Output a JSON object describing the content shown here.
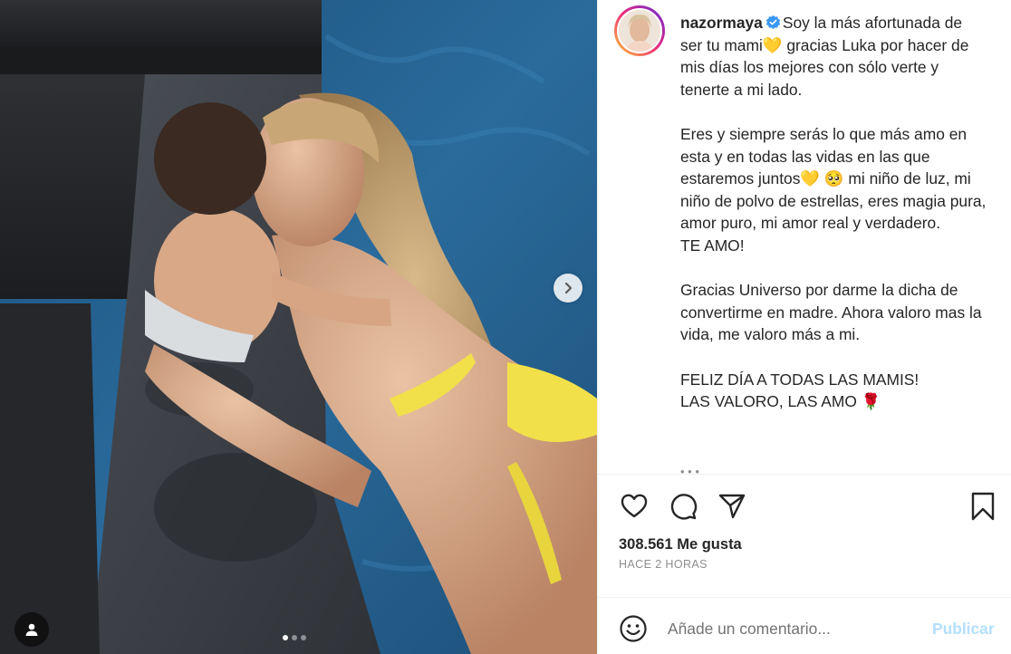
{
  "post": {
    "username": "nazormaya",
    "caption": "Soy la más afortunada de ser tu mami💛 gracias Luka por hacer de mis días los mejores con sólo verte y tenerte a mi lado.\n\nEres y siempre serás lo que más amo en esta y en todas las vidas en las que estaremos juntos💛 🥺 mi niño de luz, mi niño de polvo de estrellas, eres magia pura, amor puro, mi amor real y verdadero.\nTE AMO!\n\nGracias Universo por darme la dicha de convertirme en madre. Ahora valoro mas la vida, me valoro más a mi.\n\nFELIZ DÍA A TODAS LAS MAMIS!\nLAS VALORO, LAS AMO 🌹",
    "likes": "308.561 Me gusta",
    "time": "HACE 2 HORAS"
  },
  "comment": {
    "placeholder": "Añade un comentario...",
    "publish_label": "Publicar"
  },
  "carousel": {
    "slide_count": 3,
    "active_index": 0
  },
  "icons": {
    "like": "heart-icon",
    "comment": "comment-bubble-icon",
    "share": "paper-plane-icon",
    "save": "bookmark-icon",
    "emoji": "smiley-icon",
    "next": "chevron-right-icon",
    "tagged": "user-tag-icon",
    "verified": "verified-badge-icon"
  },
  "colors": {
    "publish_disabled": "#b2dffc",
    "verified": "#3897f0",
    "muted_text": "#8e8e8e"
  }
}
